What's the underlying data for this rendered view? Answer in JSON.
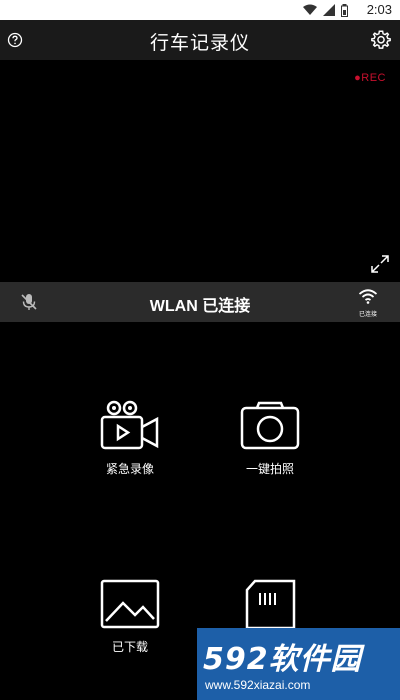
{
  "status_bar": {
    "time": "2:03"
  },
  "header": {
    "title": "行车记录仪"
  },
  "preview": {
    "rec_text": "●REC"
  },
  "wlan_bar": {
    "status": "WLAN 已连接",
    "wifi_label": "已连接"
  },
  "actions": [
    {
      "label": "紧急录像",
      "icon": "video-camera-icon"
    },
    {
      "label": "一键拍照",
      "icon": "camera-icon"
    },
    {
      "label": "已下载",
      "icon": "image-icon"
    },
    {
      "label": "",
      "icon": "sd-card-icon"
    }
  ],
  "watermark": {
    "brand": "592软件园",
    "url": "www.592xiazai.com"
  },
  "colors": {
    "accent_watermark": "#1d5fa8",
    "rec": "#c8102e",
    "header": "#1a1a1a",
    "wlan_bar": "#2b2b2b"
  }
}
